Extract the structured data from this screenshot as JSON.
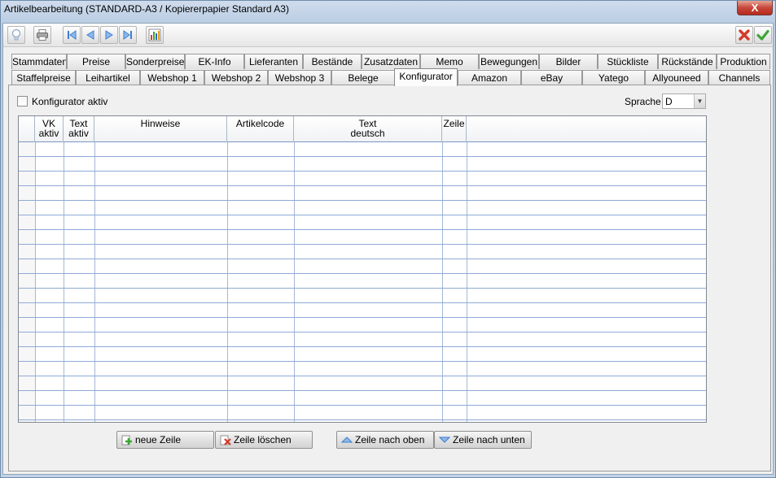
{
  "window": {
    "title": "Artikelbearbeitung (STANDARD-A3 / Kopiererpapier Standard A3)",
    "close_label": "X"
  },
  "toolbar": {
    "left_icons": [
      "lightbulb-icon",
      "printer-icon",
      "first-record-icon",
      "previous-record-icon",
      "next-record-icon",
      "last-record-icon",
      "bar-chart-icon"
    ],
    "right_icons": [
      "cancel-icon",
      "confirm-icon"
    ]
  },
  "tabs_row1": [
    "Stammdaten",
    "Preise",
    "Sonderpreise",
    "EK-Info",
    "Lieferanten",
    "Bestände",
    "Zusatzdaten",
    "Memo",
    "Bewegungen",
    "Bilder",
    "Stückliste",
    "Rückstände",
    "Produktion"
  ],
  "tabs_row2": [
    "Staffelpreise",
    "Leihartikel",
    "Webshop 1",
    "Webshop 2",
    "Webshop 3",
    "Belege",
    "Konfigurator",
    "Amazon",
    "eBay",
    "Yatego",
    "Allyouneed",
    "Channels"
  ],
  "active_tab": "Konfigurator",
  "konfigurator": {
    "checkbox_label": "Konfigurator aktiv",
    "checkbox_checked": false,
    "sprache_label": "Sprache",
    "sprache_value": "D",
    "columns": [
      {
        "line1": "VK",
        "line2": "aktiv"
      },
      {
        "line1": "Text",
        "line2": "aktiv"
      },
      {
        "line1": "Hinweise",
        "line2": ""
      },
      {
        "line1": "Artikelcode",
        "line2": ""
      },
      {
        "line1": "Text",
        "line2": "deutsch"
      },
      {
        "line1": "Zeile",
        "line2": ""
      }
    ],
    "buttons": {
      "new_row": "neue Zeile",
      "delete_row": "Zeile löschen",
      "move_up": "Zeile nach oben",
      "move_down": "Zeile nach unten"
    }
  },
  "colors": {
    "accent_blue": "#3c7fd1",
    "grid_line": "#8eaad6",
    "cancel_red": "#d43a2a",
    "confirm_green": "#3ca636"
  }
}
